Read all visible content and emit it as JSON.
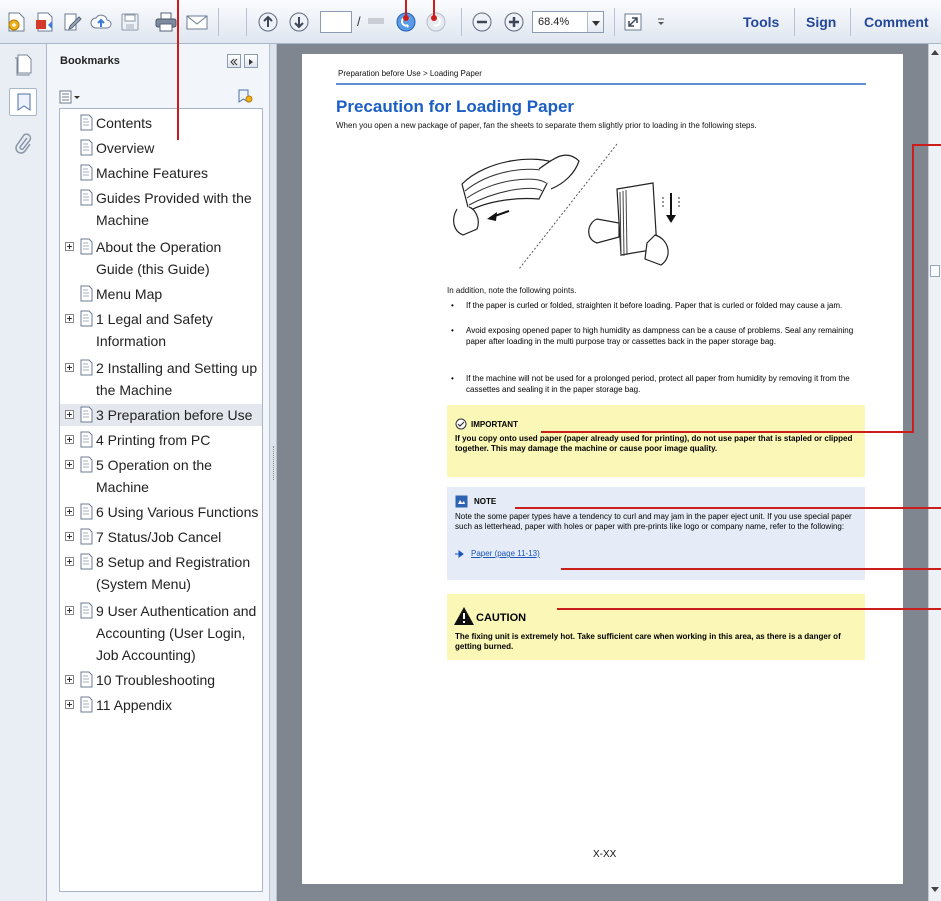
{
  "toolbar": {
    "page_slash": "/",
    "zoom": "68.4%",
    "tools_label": "Tools",
    "sign_label": "Sign",
    "comment_label": "Comment"
  },
  "panel": {
    "title": "Bookmarks"
  },
  "bookmarks": [
    {
      "label": "Contents",
      "expandable": false
    },
    {
      "label": "Overview",
      "expandable": false
    },
    {
      "label": "Machine Features",
      "expandable": false
    },
    {
      "label": "Guides Provided with the Machine",
      "expandable": false
    },
    {
      "label": "About the Operation Guide (this Guide)",
      "expandable": true
    },
    {
      "label": "Menu Map",
      "expandable": false
    },
    {
      "label": "1 Legal and Safety Information",
      "expandable": true
    },
    {
      "label": "2 Installing and Setting up the Machine",
      "expandable": true
    },
    {
      "label": "3 Preparation before Use",
      "expandable": true,
      "selected": true
    },
    {
      "label": "4 Printing from PC",
      "expandable": true
    },
    {
      "label": "5 Operation on the Machine",
      "expandable": true
    },
    {
      "label": "6 Using Various Functions",
      "expandable": true
    },
    {
      "label": "7 Status/Job Cancel",
      "expandable": true
    },
    {
      "label": "8 Setup and Registration (System Menu)",
      "expandable": true
    },
    {
      "label": "9 User Authentication and Accounting (User Login, Job Accounting)",
      "expandable": true
    },
    {
      "label": "10 Troubleshooting",
      "expandable": true
    },
    {
      "label": "11 Appendix",
      "expandable": true
    }
  ],
  "document": {
    "breadcrumb": "Preparation before Use > Loading Paper",
    "heading": "Precaution for Loading Paper",
    "intro": "When you open a new package of paper, fan the sheets to separate them slightly prior to loading in the following steps.",
    "points_title": "In addition, note the following points.",
    "bullets": [
      "If the paper is curled or folded, straighten it before loading. Paper that is curled or folded may cause a jam.",
      "Avoid exposing opened paper to high humidity as dampness can be a cause of problems. Seal any remaining paper after loading in the multi purpose tray or cassettes back in the paper storage bag.",
      "If the machine will not be used for a prolonged period, protect all paper from humidity by removing it from the cassettes and sealing it in the paper storage bag."
    ],
    "important_title": "IMPORTANT",
    "important_body": "If you copy onto used paper (paper already used for printing), do not use paper that is stapled or clipped together. This may damage the machine or cause poor image quality.",
    "note_title": "NOTE",
    "note_body": "Note the some paper types have a tendency to curl and may jam in the paper eject unit. If you use special paper such as letterhead, paper with holes or paper with pre-prints like logo or company name, refer to the following:",
    "note_link": "Paper (page 11-13)",
    "caution_title": "CAUTION",
    "caution_body": "The fixing unit is extremely hot. Take sufficient care when working in this area, as there is a danger of getting burned.",
    "page_number": "X-XX"
  },
  "colors": {
    "heading": "#1b5fc4",
    "callout": "#cc1d1d",
    "important_bg": "#fbf7b6",
    "note_bg": "#e5ecf7",
    "link": "#1a56b8"
  },
  "icons": [
    "create-pdf-icon",
    "convert-icon",
    "edit-icon",
    "upload-icon",
    "save-icon",
    "print-icon",
    "email-icon",
    "page-up-icon",
    "page-down-icon",
    "back-view-icon",
    "forward-view-icon",
    "zoom-out-icon",
    "zoom-in-icon",
    "fit-window-icon",
    "pages-icon",
    "bookmarks-icon",
    "attachments-icon",
    "bookmark-icon",
    "expand-icon",
    "collapse-panel-icon",
    "info-icon",
    "warning-icon"
  ]
}
